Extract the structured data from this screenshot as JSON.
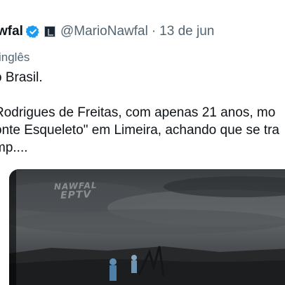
{
  "tweet": {
    "author_name": "wfal",
    "handle": "@MarioNawfal",
    "separator": "·",
    "date": "13 de jun",
    "translated_from": "inglês",
    "lines": [
      "o Brasil.",
      "Rodrigues de Freitas, com apenas 21 anos, mo",
      "onte Esqueleto\" em Limeira, achando que se tra",
      "mp...."
    ]
  },
  "media": {
    "watermark_top": "NAWFAL",
    "watermark_bottom": "EPTV"
  },
  "colors": {
    "text": "#0f1419",
    "secondary": "#536471",
    "verified": "#1d9bf0"
  },
  "icons": {
    "verified": "verified-badge-icon",
    "affiliation": "affiliate-badge-icon"
  }
}
